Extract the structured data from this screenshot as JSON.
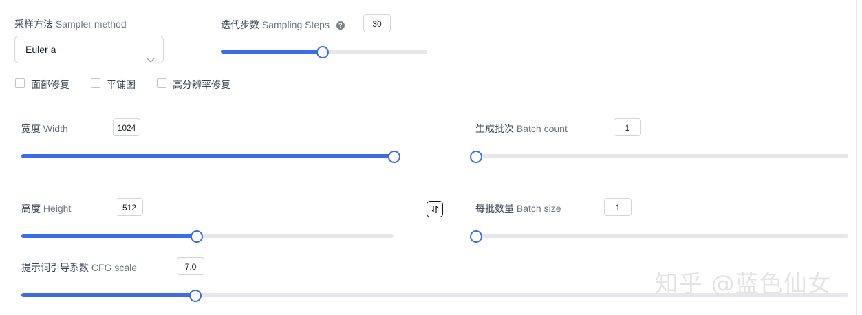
{
  "sampler": {
    "label_cn": "采样方法",
    "label_en": "Sampler method",
    "value": "Euler a"
  },
  "steps": {
    "label_cn": "迭代步数",
    "label_en": "Sampling Steps",
    "help": "?",
    "value": "30",
    "fraction": 0.49
  },
  "options": [
    {
      "label": "面部修复",
      "checked": false
    },
    {
      "label": "平铺图",
      "checked": false
    },
    {
      "label": "高分辨率修复",
      "checked": false
    }
  ],
  "width": {
    "label_cn": "宽度",
    "label_en": "Width",
    "value": "1024",
    "fraction": 1.0
  },
  "height": {
    "label_cn": "高度",
    "label_en": "Height",
    "value": "512",
    "fraction": 0.47
  },
  "batch_count": {
    "label_cn": "生成批次",
    "label_en": "Batch count",
    "value": "1",
    "fraction": 0.0
  },
  "batch_size": {
    "label_cn": "每批数量",
    "label_en": "Batch size",
    "value": "1",
    "fraction": 0.0
  },
  "cfg": {
    "label_cn": "提示词引导系数",
    "label_en": "CFG scale",
    "value": "7.0",
    "fraction": 0.21
  },
  "swap_icon": "swap-vertical-icon",
  "watermark": "知乎 @蓝色仙女",
  "colors": {
    "accent": "#3b6ce6",
    "track": "#e5e7eb"
  }
}
